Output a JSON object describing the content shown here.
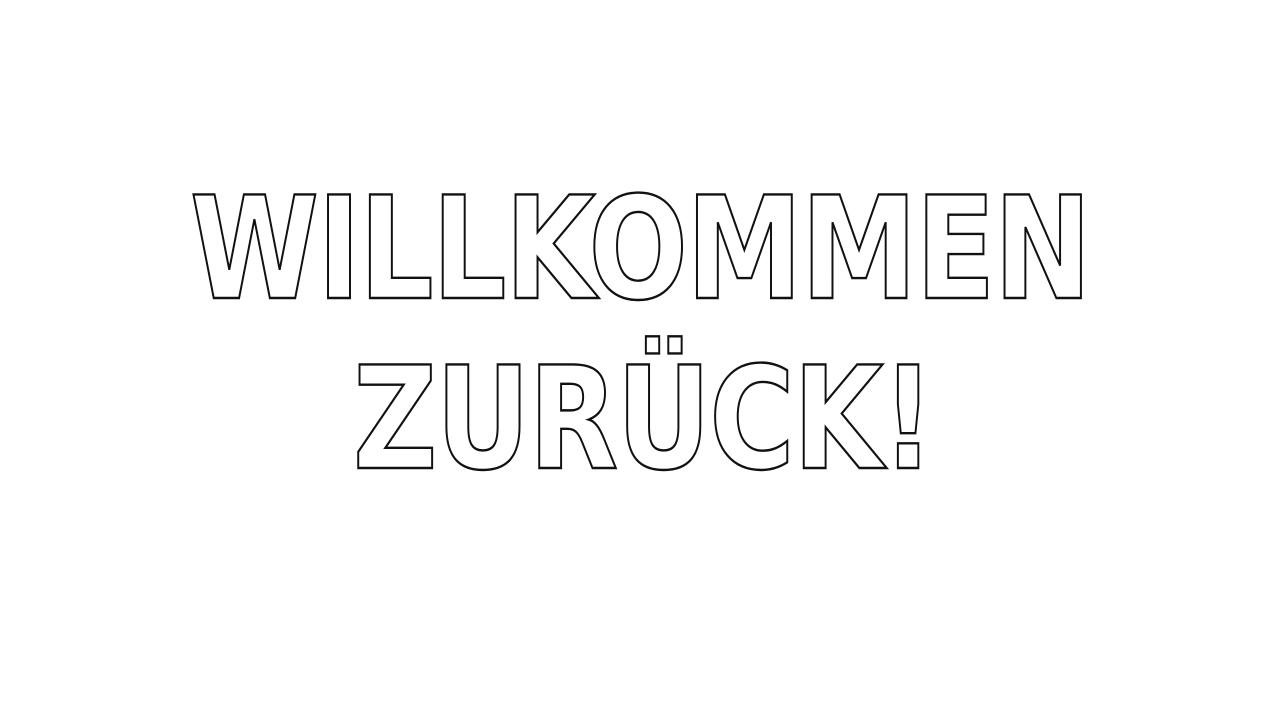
{
  "headline": {
    "line_1": "WILLKOMMEN",
    "line_2": "ZURÜCK!"
  },
  "colors": {
    "background": "#ffffff",
    "outline": "#111111"
  }
}
